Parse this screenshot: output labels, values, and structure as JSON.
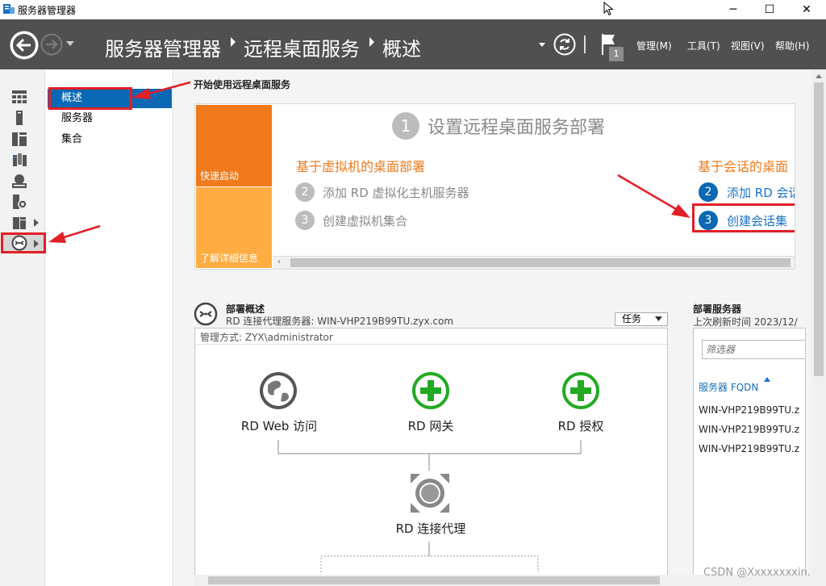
{
  "window": {
    "title": "服务器管理器",
    "min": "─",
    "max": "☐",
    "close": "✕"
  },
  "header": {
    "breadcrumb": [
      "服务器管理器",
      "远程桌面服务",
      "概述"
    ],
    "flag_badge": "1",
    "menus": [
      "管理(M)",
      "工具(T)",
      "视图(V)",
      "帮助(H)"
    ]
  },
  "nav": {
    "items": [
      "概述",
      "服务器",
      "集合"
    ]
  },
  "quickstart": {
    "heading": "开始使用远程桌面服务",
    "tiles": [
      "快速启动",
      "了解详细信息"
    ],
    "step1_num": "1",
    "step1_title": "设置远程桌面服务部署",
    "vm_title": "基于虚拟机的桌面部署",
    "vm_steps": [
      {
        "num": "2",
        "text": "添加 RD 虚拟化主机服务器"
      },
      {
        "num": "3",
        "text": "创建虚拟机集合"
      }
    ],
    "session_title": "基于会话的桌面",
    "session_steps": [
      {
        "num": "2",
        "text": "添加 RD 会话"
      },
      {
        "num": "3",
        "text": "创建会话集"
      }
    ]
  },
  "deployment": {
    "title": "部署概述",
    "subtitle": "RD 连接代理服务器: WIN-VHP219B99TU.zyx.com",
    "tasks_label": "任务",
    "managed_by": "管理方式: ZYX\\administrator",
    "roles": {
      "web": "RD Web 访问",
      "gateway": "RD 网关",
      "licensing": "RD 授权",
      "broker": "RD 连接代理"
    }
  },
  "servers": {
    "title": "部署服务器",
    "subtitle": "上次刷新时间 2023/12/",
    "filter_placeholder": "筛选器",
    "column": "服务器 FQDN",
    "rows": [
      "WIN-VHP219B99TU.z",
      "WIN-VHP219B99TU.z",
      "WIN-VHP219B99TU.z"
    ]
  },
  "watermark": "CSDN @Xxxxxxxxin.",
  "colors": {
    "accent": "#0a68b4",
    "header": "#505050",
    "orange": "#f07a1c",
    "tile_dark": "#f07a1c",
    "tile_light": "#ffad42",
    "annotation": "#e21f26",
    "role_green": "#22aa22"
  }
}
